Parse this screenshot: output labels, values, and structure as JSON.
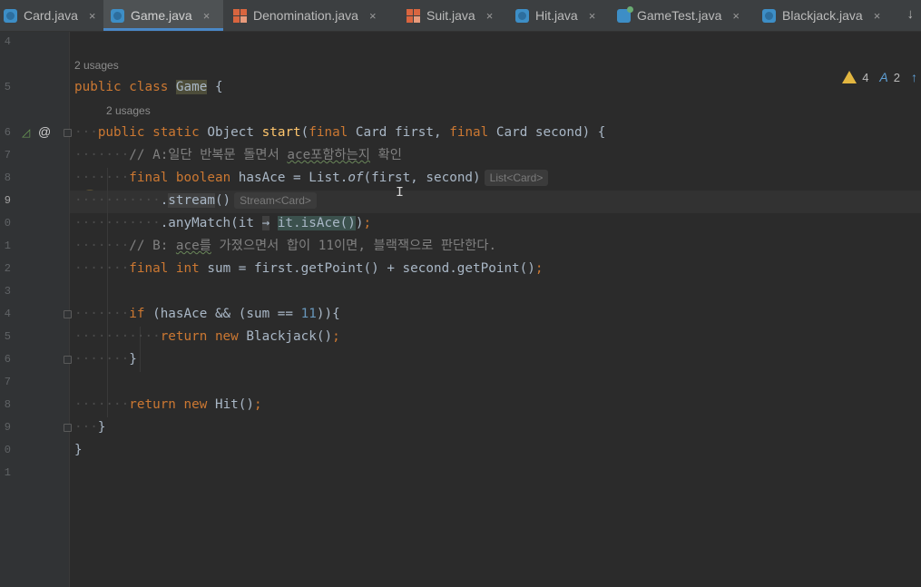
{
  "tabs": [
    {
      "label": "Card.java",
      "icon": "class-icon"
    },
    {
      "label": "Game.java",
      "icon": "class-icon",
      "active": true
    },
    {
      "label": "Denomination.java",
      "icon": "enum-icon"
    },
    {
      "label": "Suit.java",
      "icon": "enum-icon"
    },
    {
      "label": "Hit.java",
      "icon": "class-icon"
    },
    {
      "label": "GameTest.java",
      "icon": "test-icon"
    },
    {
      "label": "Blackjack.java",
      "icon": "class-icon"
    }
  ],
  "tab_close_glyph": "×",
  "tabs_more_glyph": "↓",
  "inspections": {
    "warnings": "4",
    "typos": "2"
  },
  "gutter": {
    "line_numbers": [
      "4",
      "5",
      "6",
      "7",
      "8",
      "9",
      "0",
      "1",
      "2",
      "3",
      "4",
      "5",
      "6",
      "7",
      "8",
      "9",
      "0",
      "1"
    ],
    "current_line_index": 5,
    "at_glyph": "@"
  },
  "usages": [
    "2 usages",
    "2 usages"
  ],
  "hints": {
    "list_type": "List<Card>",
    "stream_type": "Stream<Card>"
  },
  "code": {
    "l5": {
      "kw1": "public",
      "kw2": "class",
      "name": "Game",
      "rest": " {"
    },
    "l6": {
      "kw1": "public",
      "kw2": "static",
      "type": " Object ",
      "fn": "start",
      "p1": "(",
      "kw3": "final",
      "p2": " Card first, ",
      "kw4": "final",
      "p3": " Card second) {"
    },
    "l7": {
      "c1": "// A:일단 반복문 돌면서 ",
      "c2": "ace포함하는지",
      "c3": " 확인"
    },
    "l8": {
      "kw1": "final",
      "kw2": " boolean",
      "t1": " hasAce = List.",
      "it": "of",
      "t2": "(first, second)"
    },
    "l9": {
      "dot": ".",
      "fn": "stream",
      "t": "()"
    },
    "l10": {
      "t1": ".anyMatch(it ",
      "arrow": "→",
      "t2": " ",
      "ref": "it.isAce()",
      "t3": ")",
      "semi": ";"
    },
    "l11": {
      "c1": "// B: ",
      "c2": "ace를",
      "c3": " 가졌으면서 합이 11이면, 블랙잭으로 판단한다."
    },
    "l12": {
      "kw1": "final",
      "kw2": " int",
      "t": " sum = first.getPoint() + second.getPoint()",
      "semi": ";"
    },
    "l14": {
      "kw": "if",
      "t1": " (hasAce && (sum == ",
      "num": "11",
      "t2": ")){"
    },
    "l15": {
      "kw1": "return",
      "kw2": " new",
      "t": " Blackjack()",
      "semi": ";"
    },
    "l16": {
      "t": "}"
    },
    "l18": {
      "kw1": "return",
      "kw2": " new",
      "t": " Hit()",
      "semi": ";"
    },
    "l19": {
      "t": "}"
    },
    "l20": {
      "t": "}"
    }
  },
  "text_cursor_glyph": "I",
  "colors": {
    "keyword": "#cc7832",
    "function": "#ffc66d",
    "number": "#6897bb",
    "comment": "#808080",
    "accent": "#4a88c7",
    "warning": "#e2b640"
  }
}
